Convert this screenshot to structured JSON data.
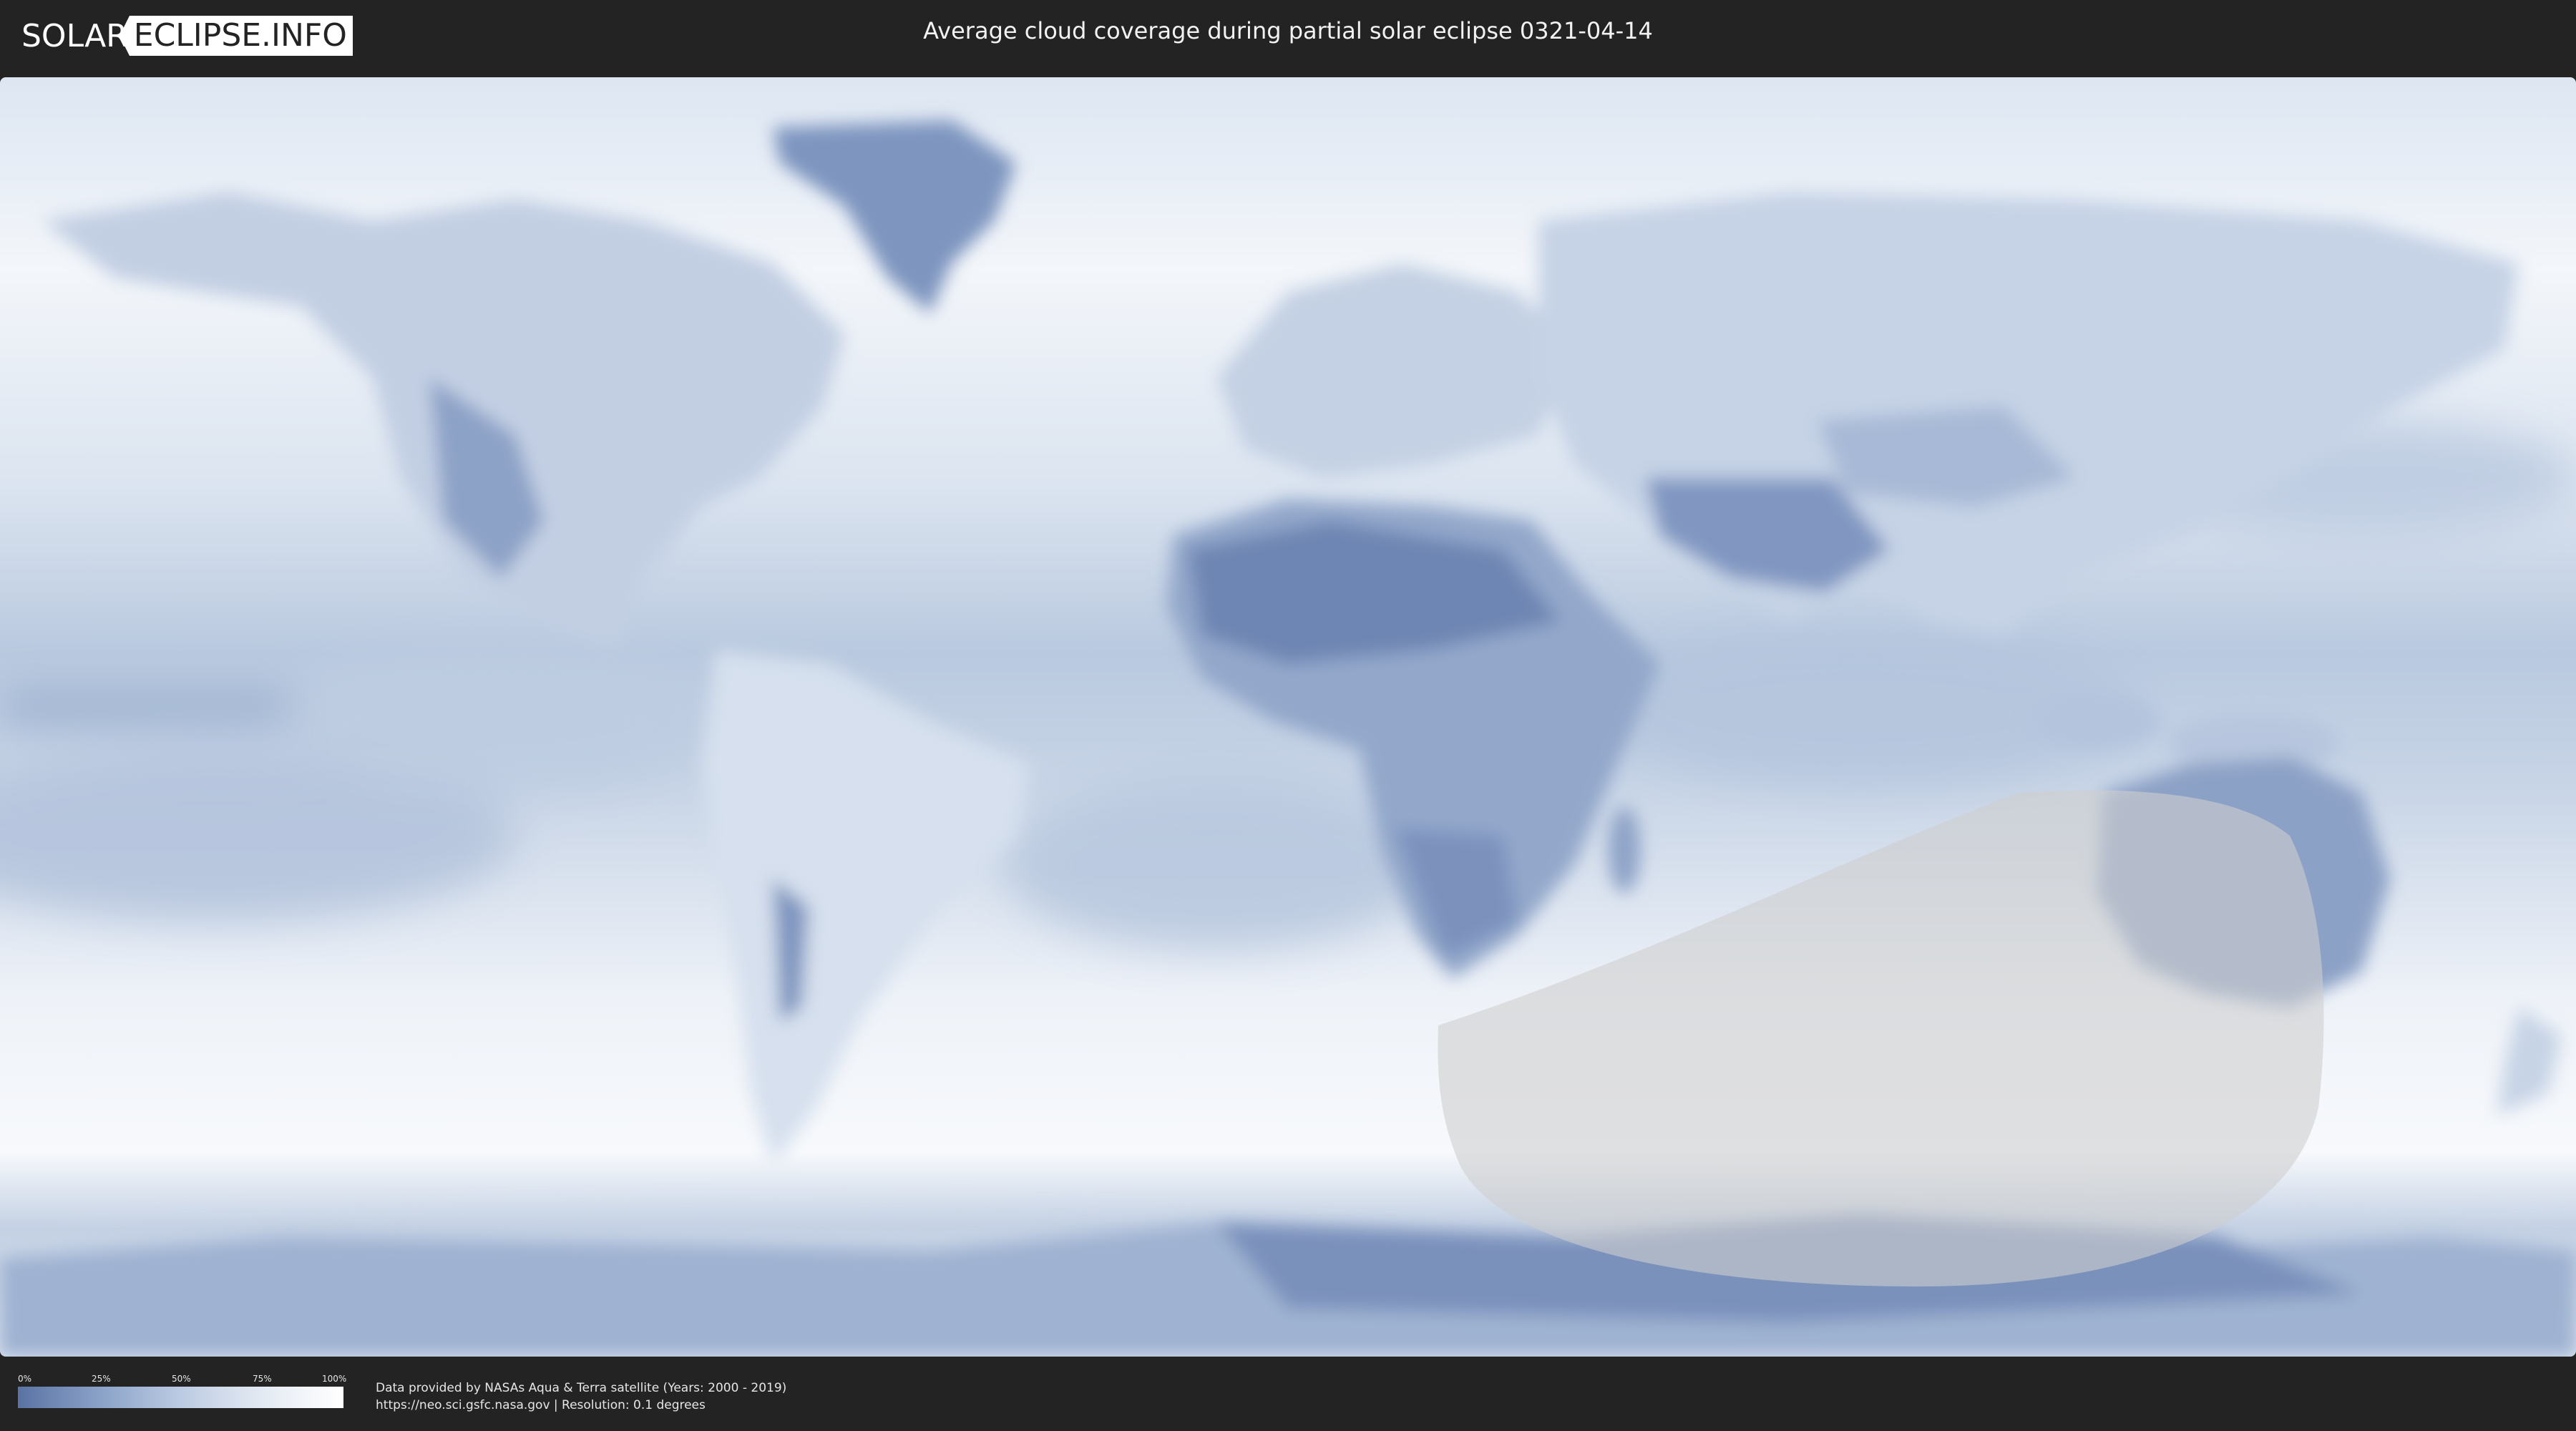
{
  "header": {
    "logo_left": "SOLAR",
    "logo_right": "ECLIPSE.INFO",
    "title": "Average cloud coverage during partial solar eclipse 0321-04-14"
  },
  "map": {
    "layer": "average cloud coverage",
    "eclipse_visibility_region_color": "#cfcfcf",
    "colors": {
      "clear": "#5a73a3",
      "cloudy": "#ffffff",
      "ocean_base": "#c9d6e8",
      "land_dark": "#7d93bd"
    }
  },
  "legend": {
    "ticks": [
      "0%",
      "25%",
      "50%",
      "75%",
      "100%"
    ]
  },
  "footer": {
    "credit_line1": "Data provided by NASAs Aqua & Terra satellite (Years: 2000 - 2019)",
    "credit_line2": "https://neo.sci.gsfc.nasa.gov | Resolution: 0.1 degrees"
  }
}
